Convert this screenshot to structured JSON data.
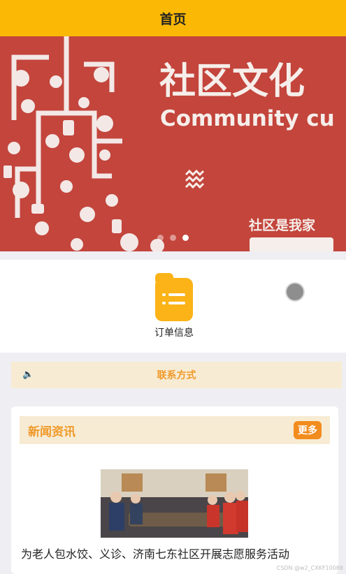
{
  "header": {
    "title": "首页"
  },
  "banner": {
    "heading": "社区文化",
    "subheading": "Community cu",
    "tagline": "社区是我家",
    "slides_total": 3,
    "slide_active": 3
  },
  "menu": {
    "items": [
      {
        "label": "订单信息",
        "icon": "document-list-icon"
      }
    ]
  },
  "notice": {
    "label": "联系方式"
  },
  "news": {
    "title": "新闻资讯",
    "more_label": "更多",
    "items": [
      {
        "title": "为老人包水饺、义诊、济南七东社区开展志愿服务活动"
      }
    ]
  },
  "watermark": "CSDN @w2_CXKF10088",
  "colors": {
    "accent": "#fbb905",
    "orange": "#f09a2a",
    "banner_bg": "#c3453c"
  }
}
